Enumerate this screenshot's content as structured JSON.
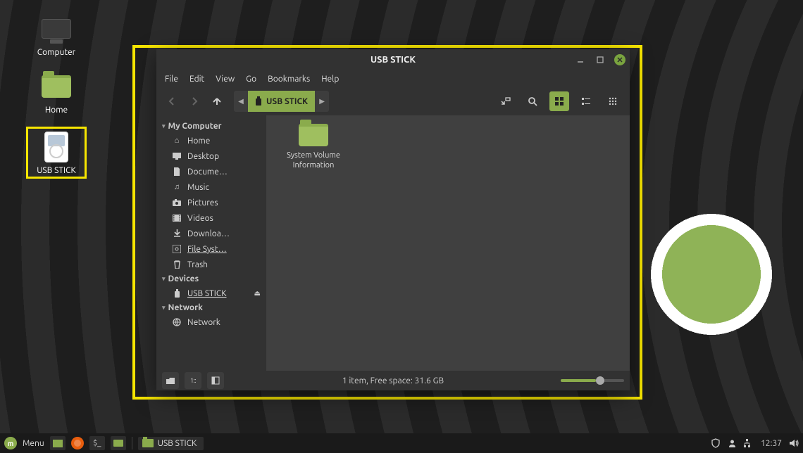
{
  "desktop": {
    "icons": [
      {
        "name": "computer",
        "label": "Computer"
      },
      {
        "name": "home",
        "label": "Home"
      },
      {
        "name": "usb-stick",
        "label": "USB STICK"
      }
    ]
  },
  "window": {
    "title": "USB STICK",
    "menu": [
      "File",
      "Edit",
      "View",
      "Go",
      "Bookmarks",
      "Help"
    ],
    "path_segment": "USB STICK",
    "sidebar": {
      "my_computer": {
        "heading": "My Computer",
        "items": [
          {
            "icon": "home",
            "label": "Home"
          },
          {
            "icon": "desktop",
            "label": "Desktop"
          },
          {
            "icon": "doc",
            "label": "Docume…"
          },
          {
            "icon": "music",
            "label": "Music"
          },
          {
            "icon": "pictures",
            "label": "Pictures"
          },
          {
            "icon": "videos",
            "label": "Videos"
          },
          {
            "icon": "download",
            "label": "Downloa…"
          },
          {
            "icon": "disk",
            "label": "File Syst…",
            "underline": true
          },
          {
            "icon": "trash",
            "label": "Trash"
          }
        ]
      },
      "devices": {
        "heading": "Devices",
        "items": [
          {
            "icon": "usb",
            "label": "USB STICK",
            "underline": true,
            "eject": true
          }
        ]
      },
      "network": {
        "heading": "Network",
        "items": [
          {
            "icon": "globe",
            "label": "Network"
          }
        ]
      }
    },
    "content": {
      "items": [
        {
          "name": "system-volume-information",
          "label": "System Volume\nInformation"
        }
      ]
    },
    "statusbar": "1 item, Free space: 31.6 GB"
  },
  "panel": {
    "menu_label": "Menu",
    "task_label": "USB STICK",
    "clock": "12:37"
  }
}
